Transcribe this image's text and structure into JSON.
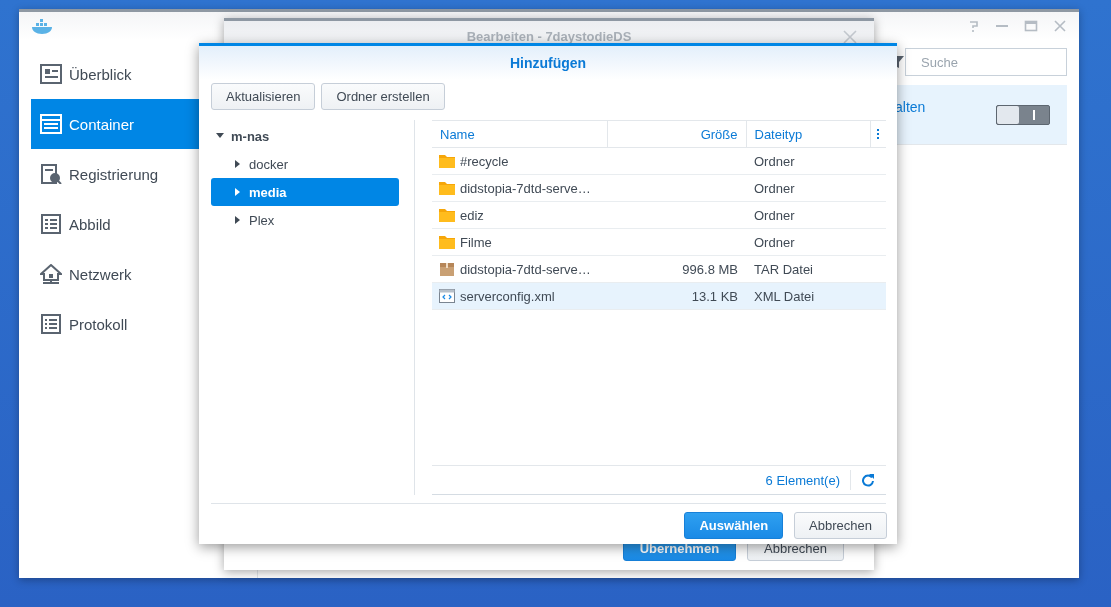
{
  "main_window": {
    "sidebar": {
      "items": [
        {
          "label": "Überblick",
          "selected": false
        },
        {
          "label": "Container",
          "selected": true
        },
        {
          "label": "Registrierung",
          "selected": false
        },
        {
          "label": "Abbild",
          "selected": false
        },
        {
          "label": "Netzwerk",
          "selected": false
        },
        {
          "label": "Protokoll",
          "selected": false
        }
      ]
    },
    "search": {
      "placeholder": "Suche"
    },
    "list_row": {
      "label": "alten",
      "selected": true,
      "toggle": {
        "on": false
      }
    }
  },
  "edit_window": {
    "title": "Bearbeiten - 7daystodieDS",
    "buttons": [
      {
        "label": "Übernehmen",
        "kind": "primary"
      },
      {
        "label": "Abbrechen",
        "kind": "normal"
      }
    ]
  },
  "add_dialog": {
    "title": "Hinzufügen",
    "toolbar": [
      "Aktualisieren",
      "Ordner erstellen"
    ],
    "tree": {
      "label": "m-nas",
      "expanded": true,
      "children": [
        {
          "label": "docker",
          "expanded": false,
          "selected": false
        },
        {
          "label": "media",
          "expanded": false,
          "selected": true
        },
        {
          "label": "Plex",
          "expanded": false,
          "selected": false
        }
      ]
    },
    "table": {
      "columns": [
        "Name",
        "Größe",
        "Dateityp"
      ],
      "rows": [
        {
          "name": "#recycle",
          "size": "",
          "type": "Ordner",
          "kind": "folder",
          "selected": false
        },
        {
          "name": "didstopia-7dtd-serve…",
          "size": "",
          "type": "Ordner",
          "kind": "folder",
          "selected": false
        },
        {
          "name": "ediz",
          "size": "",
          "type": "Ordner",
          "kind": "folder",
          "selected": false
        },
        {
          "name": "Filme",
          "size": "",
          "type": "Ordner",
          "kind": "folder",
          "selected": false
        },
        {
          "name": "didstopia-7dtd-serve…",
          "size": "996.8 MB",
          "type": "TAR Datei",
          "kind": "archive",
          "selected": false
        },
        {
          "name": "serverconfig.xml",
          "size": "13.1 KB",
          "type": "XML Datei",
          "kind": "xml",
          "selected": true
        }
      ]
    },
    "count": "6 Element(e)",
    "buttons": [
      {
        "label": "Auswählen",
        "kind": "primary"
      },
      {
        "label": "Abbrechen",
        "kind": "normal"
      }
    ]
  }
}
